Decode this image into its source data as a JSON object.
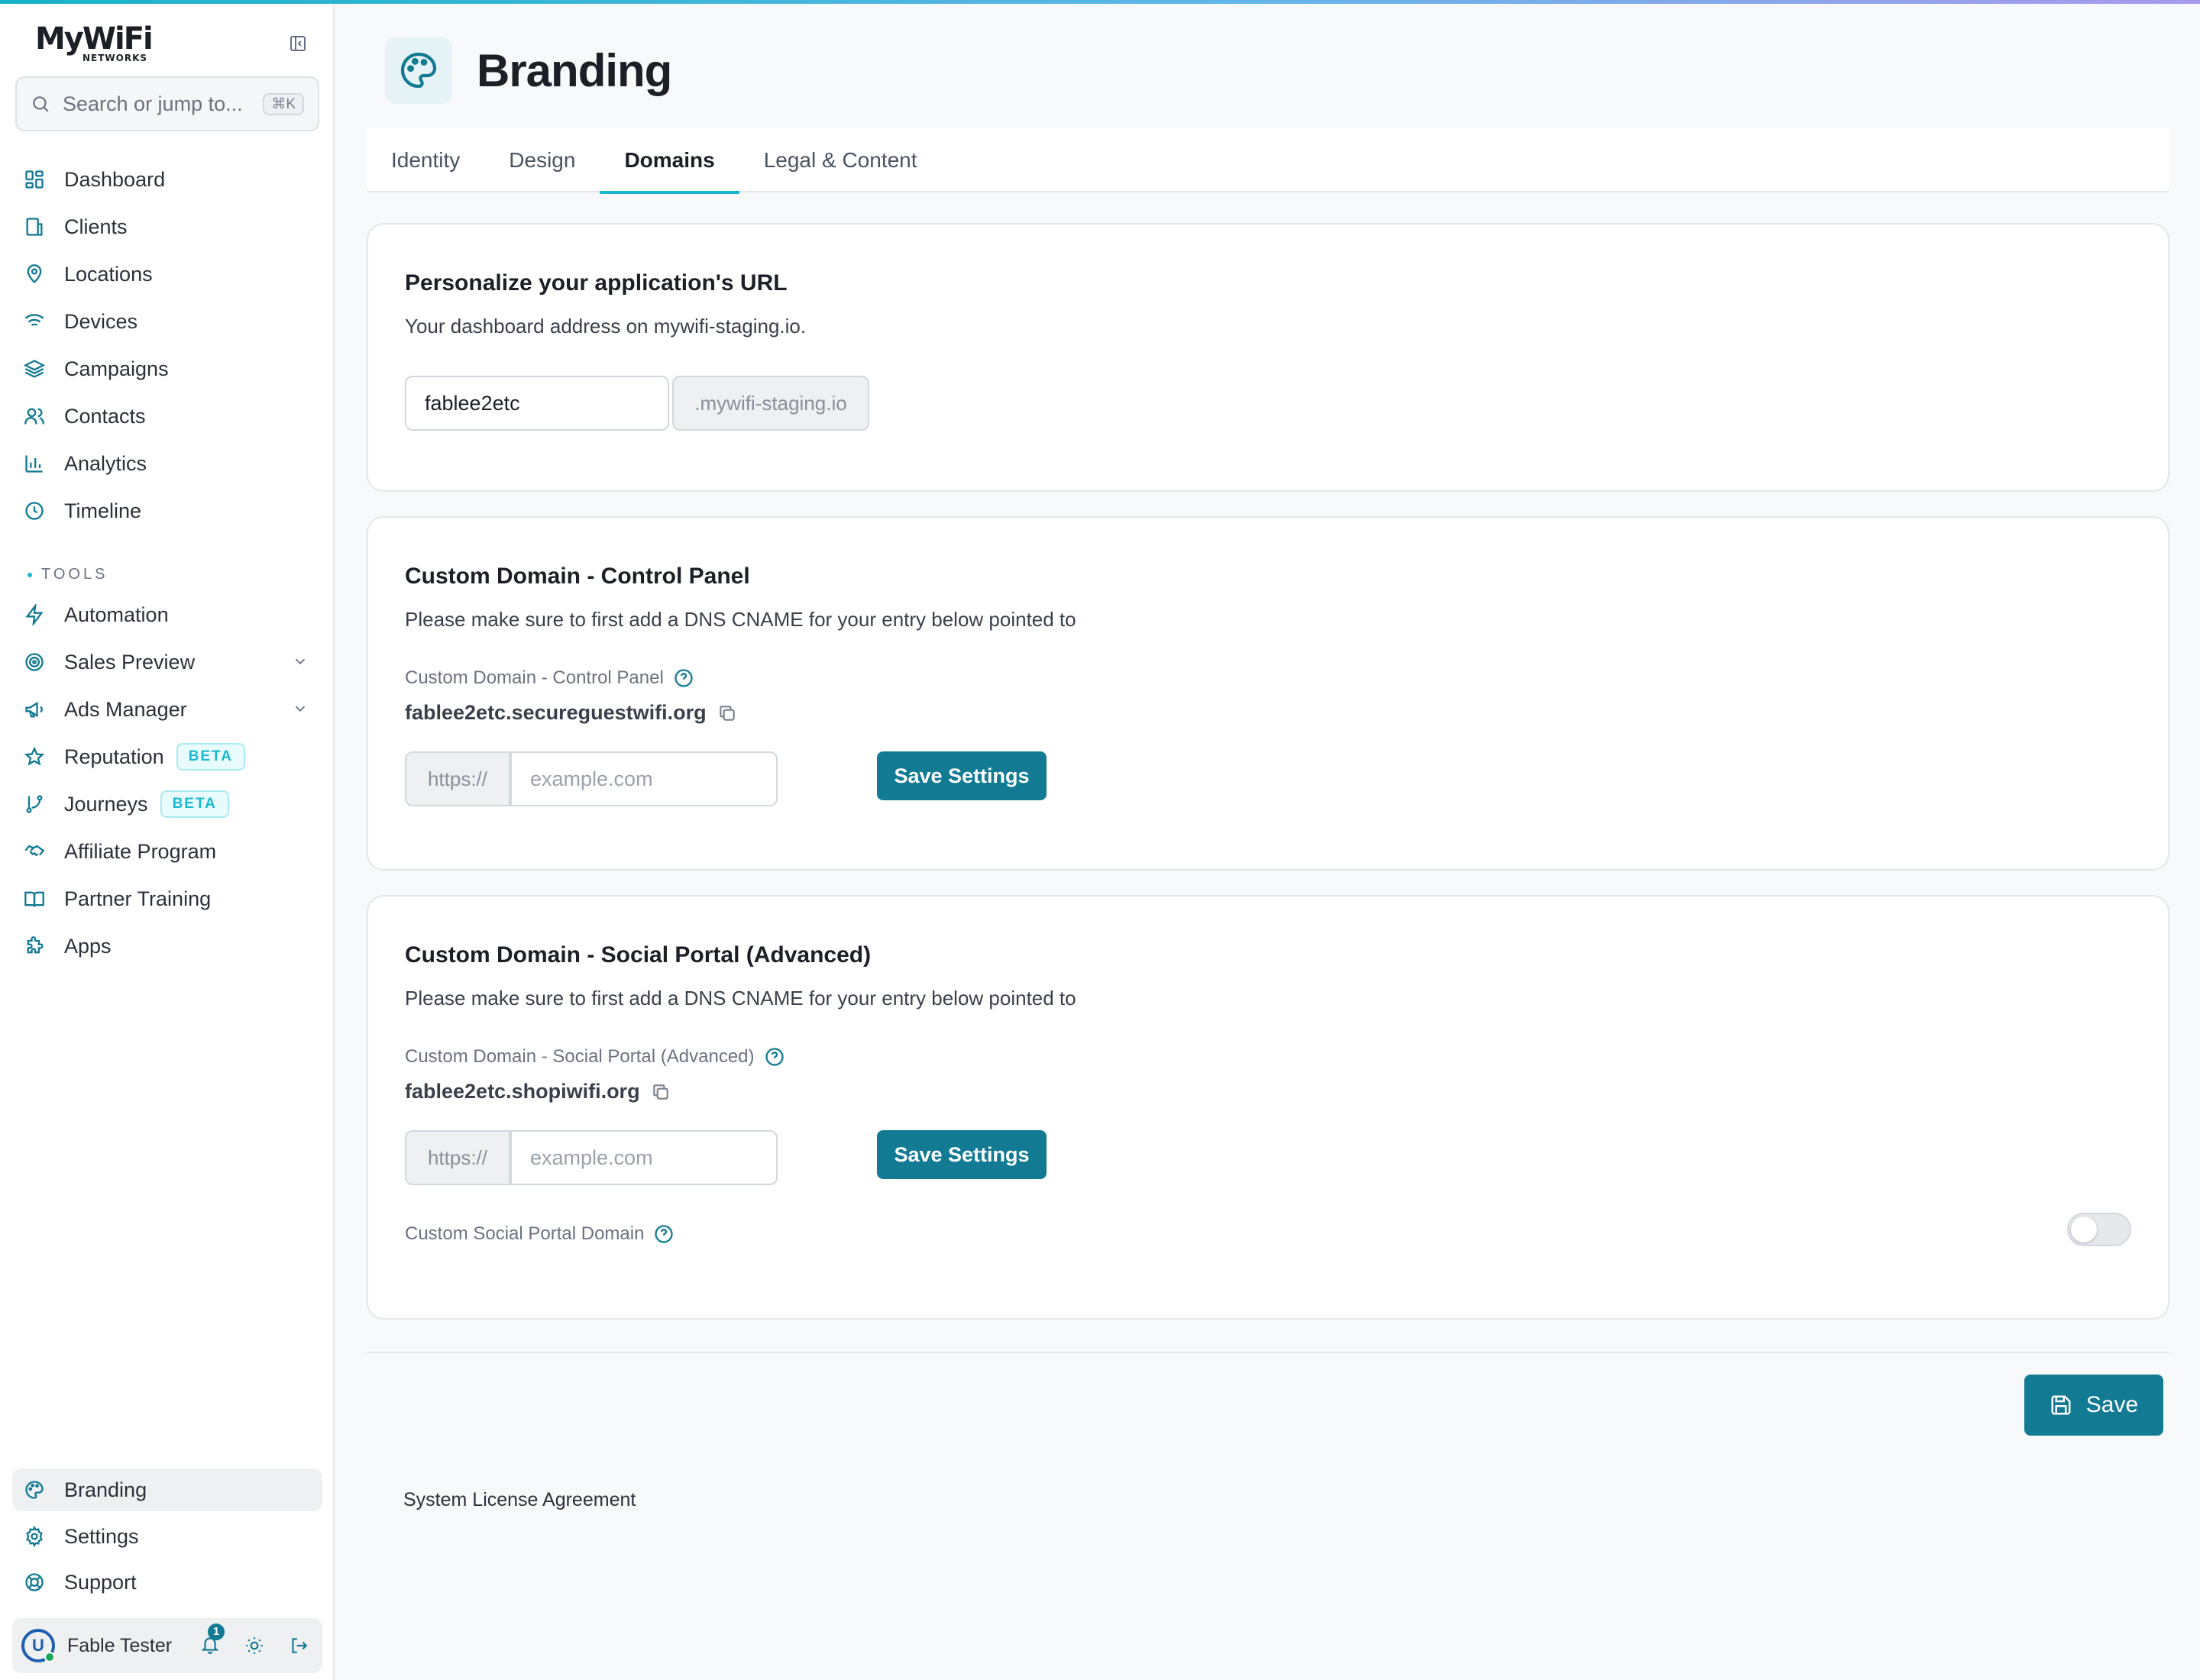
{
  "brand": {
    "logo_main": "MyWiFi",
    "logo_sub": "NETWORKS"
  },
  "search": {
    "placeholder": "Search or jump to...",
    "shortcut": "⌘K"
  },
  "sidebar": {
    "main_items": [
      {
        "label": "Dashboard",
        "icon": "dashboard-icon"
      },
      {
        "label": "Clients",
        "icon": "building-icon"
      },
      {
        "label": "Locations",
        "icon": "map-pin-icon"
      },
      {
        "label": "Devices",
        "icon": "wifi-icon"
      },
      {
        "label": "Campaigns",
        "icon": "layers-icon"
      },
      {
        "label": "Contacts",
        "icon": "users-icon"
      },
      {
        "label": "Analytics",
        "icon": "bar-chart-icon"
      },
      {
        "label": "Timeline",
        "icon": "clock-icon"
      }
    ],
    "tools_label": "TOOLS",
    "tool_items": [
      {
        "label": "Automation",
        "icon": "zap-icon"
      },
      {
        "label": "Sales Preview",
        "icon": "target-icon",
        "expandable": true
      },
      {
        "label": "Ads Manager",
        "icon": "megaphone-icon",
        "expandable": true
      },
      {
        "label": "Reputation",
        "icon": "star-icon",
        "badge": "BETA"
      },
      {
        "label": "Journeys",
        "icon": "git-branch-icon",
        "badge": "BETA"
      },
      {
        "label": "Affiliate Program",
        "icon": "handshake-icon"
      },
      {
        "label": "Partner Training",
        "icon": "book-icon"
      },
      {
        "label": "Apps",
        "icon": "puzzle-icon"
      }
    ],
    "bottom_items": [
      {
        "label": "Branding",
        "icon": "palette-icon",
        "active": true
      },
      {
        "label": "Settings",
        "icon": "gear-icon"
      },
      {
        "label": "Support",
        "icon": "life-buoy-icon"
      }
    ],
    "user": {
      "name": "Fable Tester",
      "notifications": "1"
    }
  },
  "page": {
    "title": "Branding",
    "tabs": [
      {
        "label": "Identity"
      },
      {
        "label": "Design"
      },
      {
        "label": "Domains",
        "active": true
      },
      {
        "label": "Legal & Content"
      }
    ]
  },
  "url_card": {
    "title": "Personalize your application's URL",
    "description": "Your dashboard address on mywifi-staging.io.",
    "subdomain_value": "fablee2etc",
    "suffix": ".mywifi-staging.io"
  },
  "control_panel_card": {
    "title": "Custom Domain - Control Panel",
    "description": "Please make sure to first add a DNS CNAME for your entry below pointed to",
    "field_label": "Custom Domain - Control Panel",
    "cname_target": "fablee2etc.secureguestwifi.org",
    "prefix": "https://",
    "placeholder": "example.com",
    "button": "Save Settings"
  },
  "social_portal_card": {
    "title": "Custom Domain - Social Portal (Advanced)",
    "description": "Please make sure to first add a DNS CNAME for your entry below pointed to",
    "field_label": "Custom Domain - Social Portal (Advanced)",
    "cname_target": "fablee2etc.shopiwifi.org",
    "prefix": "https://",
    "placeholder": "example.com",
    "button": "Save Settings",
    "toggle_label": "Custom Social Portal Domain",
    "toggle_on": false
  },
  "actions": {
    "save": "Save"
  },
  "footer": {
    "license_link": "System License Agreement"
  },
  "colors": {
    "primary": "#127a93",
    "accent": "#18b9cf"
  }
}
